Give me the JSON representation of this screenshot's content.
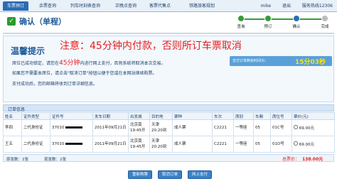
{
  "nav": {
    "tabs": [
      "车票预订",
      "余票查询",
      "列车时刻表查询",
      "正晚点查询",
      "客票代售点",
      "铁路旅客规划"
    ],
    "active_index": 0
  },
  "user": {
    "name": "mike",
    "logout": "退出",
    "hotline": "服务热线12306"
  },
  "page": {
    "title": "确认（单程）"
  },
  "steps": {
    "labels": [
      "查询",
      "预订",
      "确认",
      "完成"
    ],
    "current_index": 2
  },
  "notice": {
    "title": "温馨提示",
    "warning": "注意：45分钟内付款，否则所订车票取消",
    "line1_prefix": "席位已成功锁定，请您在",
    "line1_highlight": "45分钟",
    "line1_suffix": "内进行网上支付，否则系统将取消本次交易。",
    "line2": "如果您不需要本席位，请点击\"取消订单\"按钮以便于您或在本网站继续购票。",
    "line3": "支付成功后，您的邮箱将收到订单详细信息。",
    "countdown_label": "支付订单剩余时间为：",
    "countdown_time": "15分03秒"
  },
  "order": {
    "section_title": "订单信息",
    "columns": [
      "姓名",
      "证件类型",
      "证件号",
      "发车日期",
      "出发城",
      "目的地",
      "票种",
      "车次",
      "席别",
      "车厢",
      "席位号",
      "票价(元)"
    ],
    "rows": [
      {
        "name": "李四",
        "id_type": "二代身份证",
        "id_prefix": "37010",
        "date": "2011年09月21日",
        "from": "北京南",
        "depart": "19:45开",
        "to": "天津",
        "arrive": "20:20到",
        "ticket_type": "成人票",
        "train": "C2221",
        "seat_class": "一等座",
        "car": "05",
        "seat": "01C号",
        "price": "69.00元"
      },
      {
        "name": "王五",
        "id_type": "二代身份证",
        "id_prefix": "37010",
        "date": "2011年09月21日",
        "from": "北京南",
        "depart": "19:45开",
        "to": "天津",
        "arrive": "20:20到",
        "ticket_type": "成人票",
        "train": "C2221",
        "seat_class": "一等座",
        "car": "05",
        "seat": "01D号",
        "price": "69.00元"
      }
    ],
    "summary_counts": "原张数：2张　　　　现张数：2张",
    "total_label": "总票价：",
    "total_value": "138.00元"
  },
  "buttons": {
    "rebook": "重新购票",
    "cancel": "取消订单",
    "pay": "网上支付"
  },
  "colors": {
    "brand_blue": "#2a6cb5",
    "warning_red": "#e61c1c",
    "step_green": "#3a9a3a",
    "countdown_bg": "#5aa0d8",
    "countdown_text": "#ffe400"
  }
}
